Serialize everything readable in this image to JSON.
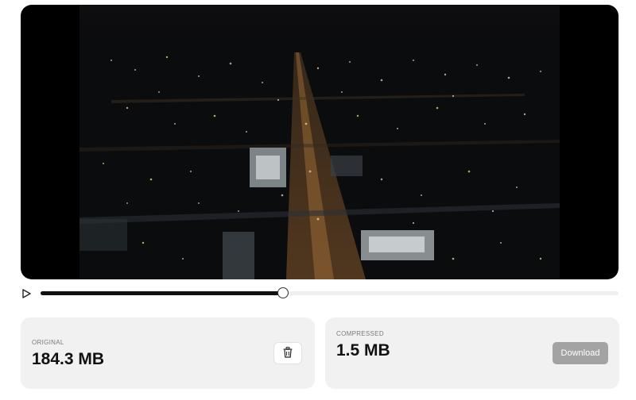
{
  "player": {
    "video_description": "Aerial night view of a city with a lit main street",
    "progress_fraction": 0.42,
    "play_icon": "play-icon"
  },
  "original": {
    "label": "ORIGINAL",
    "size": "184.3 MB",
    "delete_icon": "trash-icon"
  },
  "compressed": {
    "label": "COMPRESSED",
    "size": "1.5 MB",
    "download_label": "Download"
  },
  "colors": {
    "card_bg": "#f1f1f1",
    "download_bg": "#a3a3a3",
    "seek_fill": "#111111",
    "seek_track": "#efefef"
  }
}
